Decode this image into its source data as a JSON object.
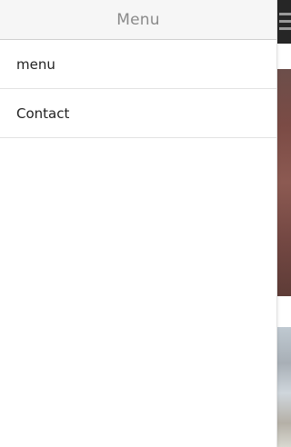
{
  "panel": {
    "title": "Menu",
    "items": [
      {
        "label": "menu"
      },
      {
        "label": "Contact"
      }
    ]
  },
  "background_page": {
    "menu_icon": "hamburger-icon"
  },
  "colors": {
    "panel_header_bg": "#f6f6f6",
    "panel_title": "#8a8a8a",
    "item_text": "#222222",
    "topbar": "#262626"
  }
}
